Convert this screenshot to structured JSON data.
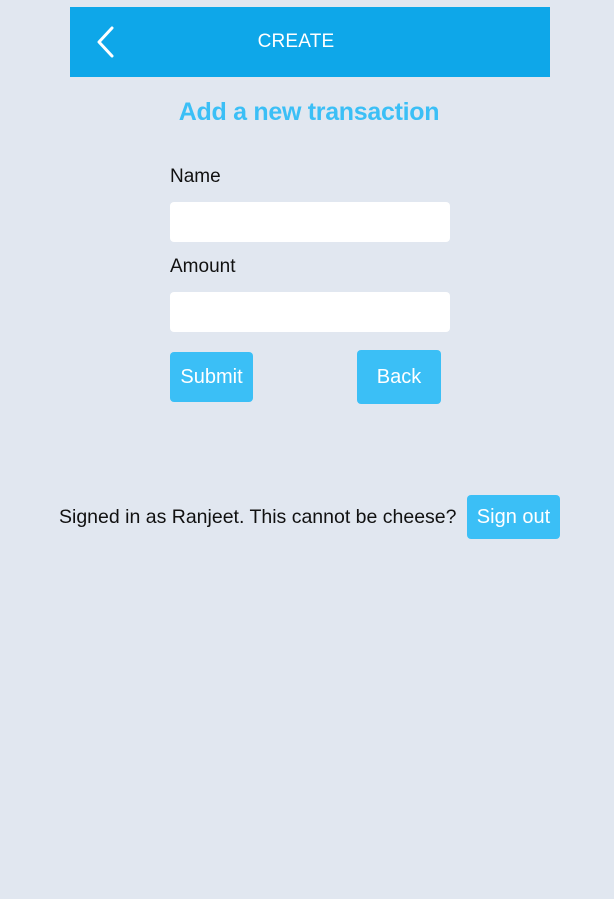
{
  "header": {
    "title": "CREATE",
    "back_icon": "chevron-left-icon",
    "background_color": "#0ea7e9"
  },
  "form": {
    "heading": "Add a new transaction",
    "name_label": "Name",
    "name_value": "",
    "name_placeholder": "",
    "amount_label": "Amount",
    "amount_value": "",
    "amount_placeholder": "",
    "submit_label": "Submit",
    "back_label": "Back"
  },
  "auth": {
    "signed_in_text": "Signed in as Ranjeet. This cannot be cheese?",
    "sign_out_label": "Sign out"
  },
  "colors": {
    "accent": "#3bbff6",
    "page_background": "#e1e7f0"
  }
}
